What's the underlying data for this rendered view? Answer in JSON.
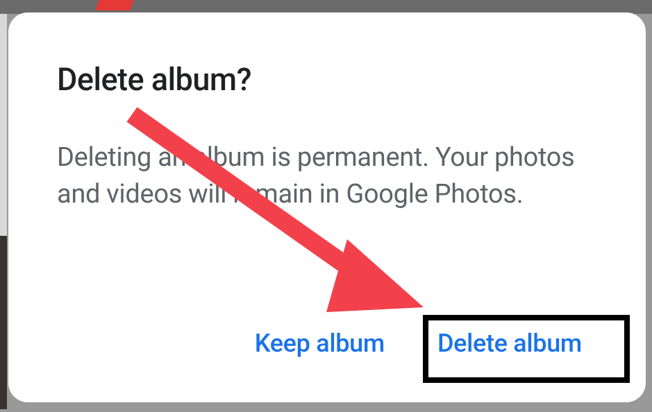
{
  "dialog": {
    "title": "Delete album?",
    "body": "Deleting an album is permanent. Your photos and videos will remain in Google Photos.",
    "keep_label": "Keep album",
    "delete_label": "Delete album"
  },
  "annotation": {
    "arrow_color": "#f2414b",
    "highlight_target": "delete-album-button"
  }
}
